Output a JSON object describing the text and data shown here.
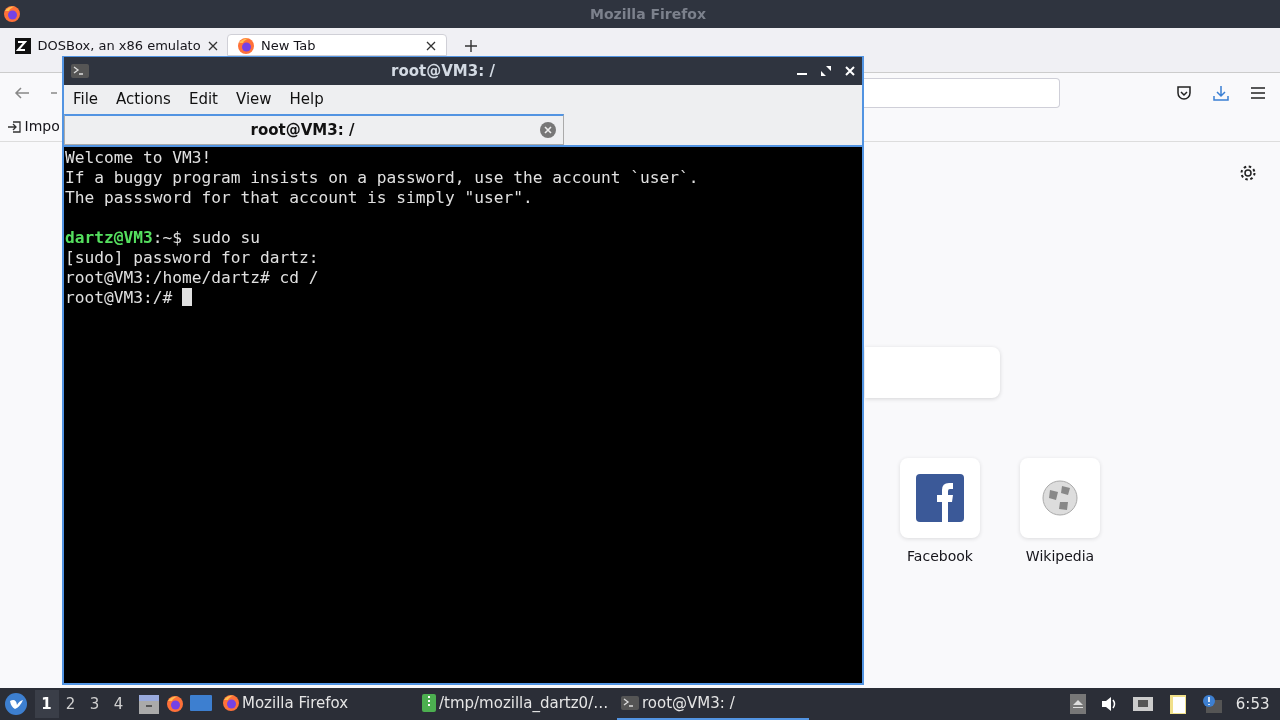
{
  "firefox": {
    "title": "Mozilla Firefox",
    "tabs": [
      {
        "label": "DOSBox, an x86 emulato",
        "kind": "dosbox",
        "selected": false
      },
      {
        "label": "New Tab",
        "kind": "firefox",
        "selected": true
      }
    ],
    "bookmarks": [
      {
        "label": "Impo"
      }
    ],
    "shortcuts": [
      {
        "label": "Facebook",
        "kind": "facebook"
      },
      {
        "label": "Wikipedia",
        "kind": "wikipedia"
      }
    ]
  },
  "terminal": {
    "title": "root@VM3: /",
    "menu": [
      "File",
      "Actions",
      "Edit",
      "View",
      "Help"
    ],
    "tabs": [
      {
        "label": "root@VM3: /",
        "selected": true
      }
    ],
    "lines": [
      {
        "segments": [
          {
            "text": "Welcome to VM3!",
            "kind": "plain"
          }
        ]
      },
      {
        "segments": [
          {
            "text": "If a buggy program insists on a password, use the account `user`.",
            "kind": "plain"
          }
        ]
      },
      {
        "segments": [
          {
            "text": "The passsword for that account is simply \"user\".",
            "kind": "plain"
          }
        ]
      },
      {
        "gap_before": true,
        "segments": [
          {
            "text": "dartz@VM3",
            "kind": "prompt"
          },
          {
            "text": ":~$ sudo su",
            "kind": "plain"
          }
        ]
      },
      {
        "segments": [
          {
            "text": "[sudo] password for dartz:",
            "kind": "plain"
          }
        ]
      },
      {
        "segments": [
          {
            "text": "root@VM3:/home/dartz# cd /",
            "kind": "plain"
          }
        ]
      },
      {
        "segments": [
          {
            "text": "root@VM3:/# ",
            "kind": "plain"
          }
        ],
        "cursor": true
      }
    ]
  },
  "taskbar": {
    "workspaces": [
      {
        "label": "1",
        "selected": true
      },
      {
        "label": "2",
        "selected": false
      },
      {
        "label": "3",
        "selected": false
      },
      {
        "label": "4",
        "selected": false
      }
    ],
    "tasks": [
      {
        "label": "Mozilla Firefox",
        "kind": "firefox",
        "selected": false
      },
      {
        "label": "/tmp/mozilla_dartz0/…",
        "kind": "archive",
        "selected": false
      },
      {
        "label": "root@VM3: /",
        "kind": "terminal",
        "selected": true
      }
    ],
    "clock": "6:53"
  }
}
